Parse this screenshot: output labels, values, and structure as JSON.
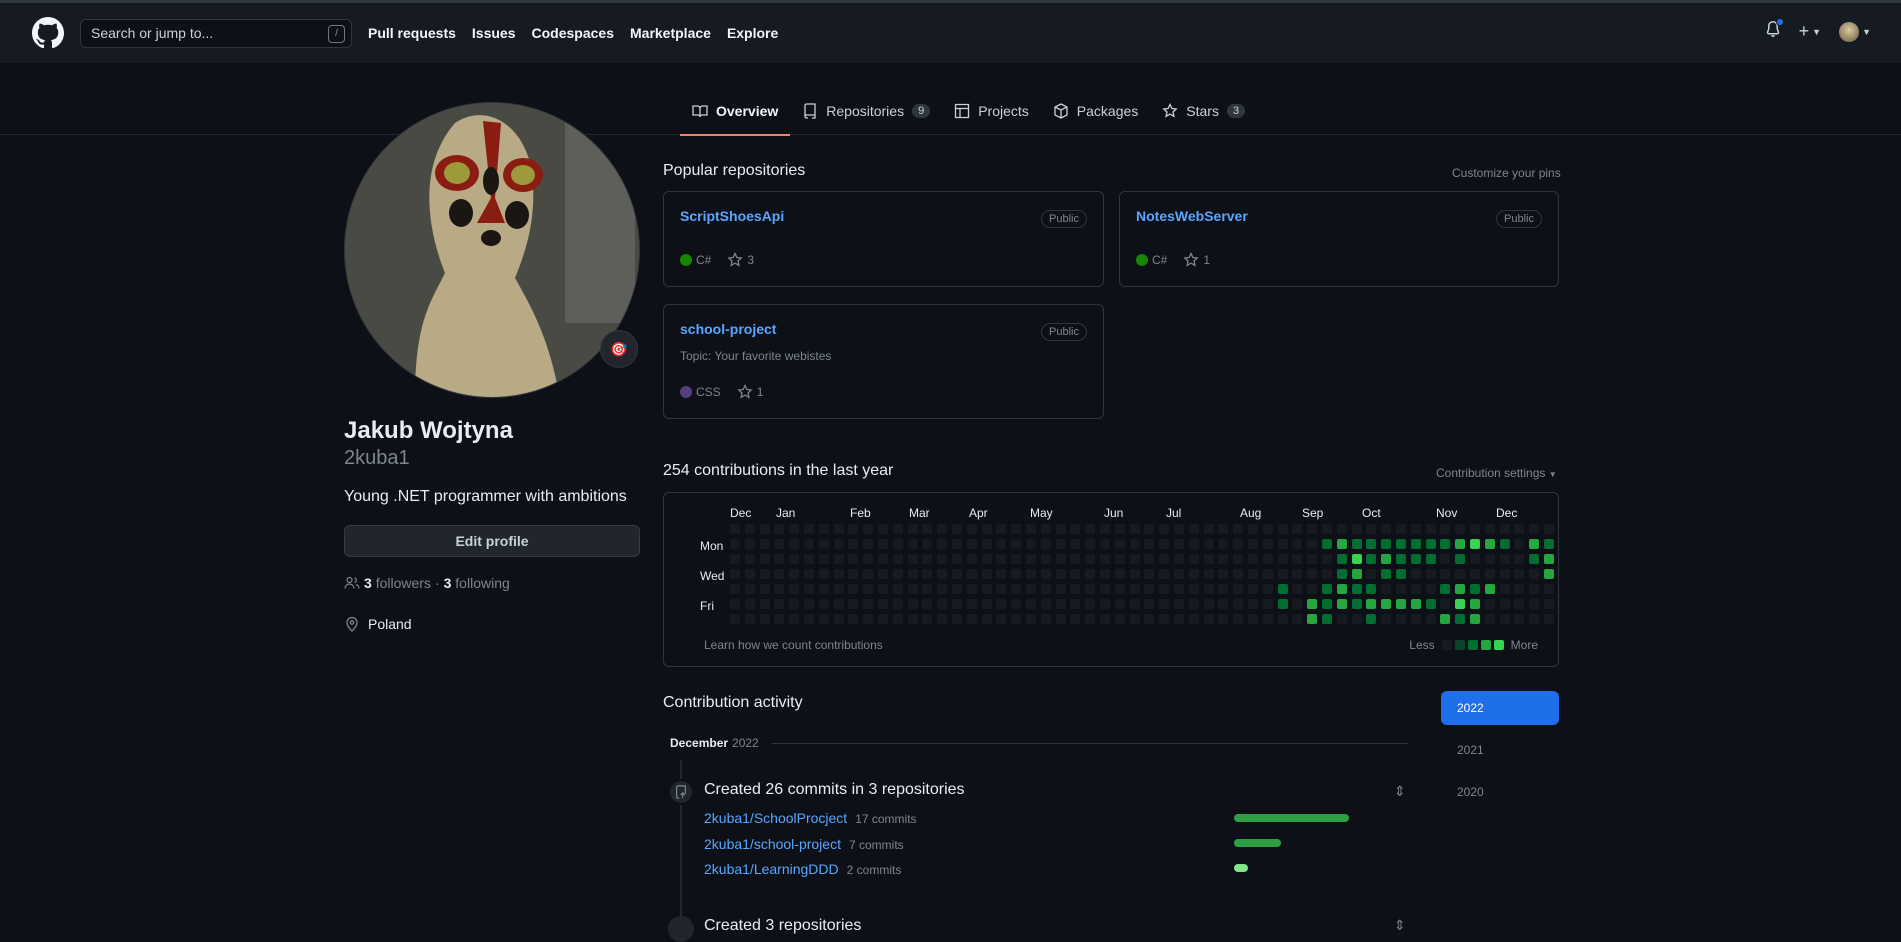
{
  "header": {
    "search_placeholder": "Search or jump to...",
    "search_shortcut": "/",
    "nav": [
      "Pull requests",
      "Issues",
      "Codespaces",
      "Marketplace",
      "Explore"
    ],
    "plus_label": "+"
  },
  "tabs": [
    {
      "label": "Overview",
      "count": null,
      "icon": "book-icon",
      "active": true
    },
    {
      "label": "Repositories",
      "count": "9",
      "icon": "repo-icon",
      "active": false
    },
    {
      "label": "Projects",
      "count": null,
      "icon": "table-icon",
      "active": false
    },
    {
      "label": "Packages",
      "count": null,
      "icon": "package-icon",
      "active": false
    },
    {
      "label": "Stars",
      "count": "3",
      "icon": "star-icon",
      "active": false
    }
  ],
  "profile": {
    "fullname": "Jakub Wojtyna",
    "username": "2kuba1",
    "bio": "Young .NET programmer with ambitions",
    "edit_label": "Edit profile",
    "followers_count": "3",
    "followers_label": "followers",
    "separator": "·",
    "following_count": "3",
    "following_label": "following",
    "location": "Poland",
    "status_emoji": "🎯"
  },
  "popular": {
    "title": "Popular repositories",
    "customize": "Customize your pins",
    "repos": [
      {
        "name": "ScriptShoesApi",
        "visibility": "Public",
        "description": "",
        "language": "C#",
        "lang_color": "#178600",
        "stars": "3"
      },
      {
        "name": "NotesWebServer",
        "visibility": "Public",
        "description": "",
        "language": "C#",
        "lang_color": "#178600",
        "stars": "1"
      },
      {
        "name": "school-project",
        "visibility": "Public",
        "description": "Topic: Your favorite webistes",
        "language": "CSS",
        "lang_color": "#563d7c",
        "stars": "1"
      }
    ]
  },
  "contributions": {
    "title": "254 contributions in the last year",
    "settings": "Contribution settings",
    "months": [
      "Dec",
      "Jan",
      "Feb",
      "Mar",
      "Apr",
      "May",
      "Jun",
      "Jul",
      "Aug",
      "Sep",
      "Oct",
      "Nov",
      "Dec"
    ],
    "days": [
      "Mon",
      "Wed",
      "Fri"
    ],
    "learn": "Learn how we count contributions",
    "less": "Less",
    "more": "More",
    "colors": [
      "#161b22",
      "#0e4429",
      "#006d32",
      "#26a641",
      "#39d353"
    ],
    "levels": [
      [
        0,
        0,
        0,
        0,
        0,
        0,
        0
      ],
      [
        0,
        0,
        0,
        0,
        0,
        0,
        0
      ],
      [
        0,
        0,
        0,
        0,
        0,
        0,
        0
      ],
      [
        0,
        0,
        0,
        0,
        0,
        0,
        0
      ],
      [
        0,
        0,
        0,
        0,
        0,
        0,
        0
      ],
      [
        0,
        0,
        0,
        0,
        0,
        0,
        0
      ],
      [
        0,
        0,
        0,
        0,
        0,
        0,
        0
      ],
      [
        0,
        0,
        0,
        0,
        0,
        0,
        0
      ],
      [
        0,
        0,
        0,
        0,
        0,
        0,
        0
      ],
      [
        0,
        0,
        0,
        0,
        0,
        0,
        0
      ],
      [
        0,
        0,
        0,
        0,
        0,
        0,
        0
      ],
      [
        0,
        0,
        0,
        0,
        0,
        0,
        0
      ],
      [
        0,
        0,
        0,
        0,
        0,
        0,
        0
      ],
      [
        0,
        0,
        0,
        0,
        0,
        0,
        0
      ],
      [
        0,
        0,
        0,
        0,
        0,
        0,
        0
      ],
      [
        0,
        0,
        0,
        0,
        0,
        0,
        0
      ],
      [
        0,
        0,
        0,
        0,
        0,
        0,
        0
      ],
      [
        0,
        0,
        0,
        0,
        0,
        0,
        0
      ],
      [
        0,
        0,
        0,
        0,
        0,
        0,
        0
      ],
      [
        0,
        0,
        0,
        0,
        0,
        0,
        0
      ],
      [
        0,
        0,
        0,
        0,
        0,
        0,
        0
      ],
      [
        0,
        0,
        0,
        0,
        0,
        0,
        0
      ],
      [
        0,
        0,
        0,
        0,
        0,
        0,
        0
      ],
      [
        0,
        0,
        0,
        0,
        0,
        0,
        0
      ],
      [
        0,
        0,
        0,
        0,
        0,
        0,
        0
      ],
      [
        0,
        0,
        0,
        0,
        0,
        0,
        0
      ],
      [
        0,
        0,
        0,
        0,
        0,
        0,
        0
      ],
      [
        0,
        0,
        0,
        0,
        0,
        0,
        0
      ],
      [
        0,
        0,
        0,
        0,
        0,
        0,
        0
      ],
      [
        0,
        0,
        0,
        0,
        0,
        0,
        0
      ],
      [
        0,
        0,
        0,
        0,
        0,
        0,
        0
      ],
      [
        0,
        0,
        0,
        0,
        0,
        0,
        0
      ],
      [
        0,
        0,
        0,
        0,
        0,
        0,
        0
      ],
      [
        0,
        0,
        0,
        0,
        0,
        0,
        0
      ],
      [
        0,
        0,
        0,
        0,
        0,
        0,
        0
      ],
      [
        0,
        0,
        0,
        0,
        0,
        0,
        0
      ],
      [
        0,
        0,
        0,
        0,
        0,
        0,
        0
      ],
      [
        0,
        0,
        0,
        0,
        2,
        2,
        0
      ],
      [
        0,
        0,
        0,
        0,
        0,
        0,
        0
      ],
      [
        0,
        0,
        0,
        0,
        0,
        3,
        3
      ],
      [
        0,
        2,
        0,
        0,
        2,
        2,
        2
      ],
      [
        0,
        3,
        2,
        2,
        3,
        3,
        0
      ],
      [
        0,
        2,
        4,
        3,
        2,
        2,
        0
      ],
      [
        0,
        2,
        2,
        0,
        2,
        3,
        2
      ],
      [
        0,
        2,
        3,
        2,
        0,
        3,
        0
      ],
      [
        0,
        2,
        2,
        2,
        0,
        3,
        0
      ],
      [
        0,
        2,
        2,
        0,
        0,
        3,
        0
      ],
      [
        0,
        2,
        2,
        0,
        0,
        2,
        0
      ],
      [
        0,
        2,
        0,
        0,
        2,
        0,
        3
      ],
      [
        0,
        3,
        2,
        0,
        3,
        4,
        2
      ],
      [
        0,
        4,
        0,
        0,
        2,
        3,
        3
      ],
      [
        0,
        3,
        0,
        0,
        3,
        0,
        0
      ],
      [
        0,
        2,
        0,
        0,
        0,
        0,
        0
      ],
      [
        0,
        0,
        0,
        0,
        0,
        0,
        0
      ],
      [
        0,
        3,
        2,
        0,
        0,
        0,
        0
      ],
      [
        0,
        2,
        3,
        3,
        0,
        0,
        0
      ]
    ]
  },
  "activity": {
    "title": "Contribution activity",
    "month": "December",
    "month_year": "2022",
    "years": [
      "2022",
      "2021",
      "2020"
    ],
    "commits_title": "Created 26 commits in 3 repositories",
    "commits": [
      {
        "repo": "2kuba1/SchoolProcject",
        "count": "17 commits",
        "value": 17
      },
      {
        "repo": "2kuba1/school-project",
        "count": "7 commits",
        "value": 7
      },
      {
        "repo": "2kuba1/LearningDDD",
        "count": "2 commits",
        "value": 2
      }
    ],
    "next_title": "Created 3 repositories"
  }
}
